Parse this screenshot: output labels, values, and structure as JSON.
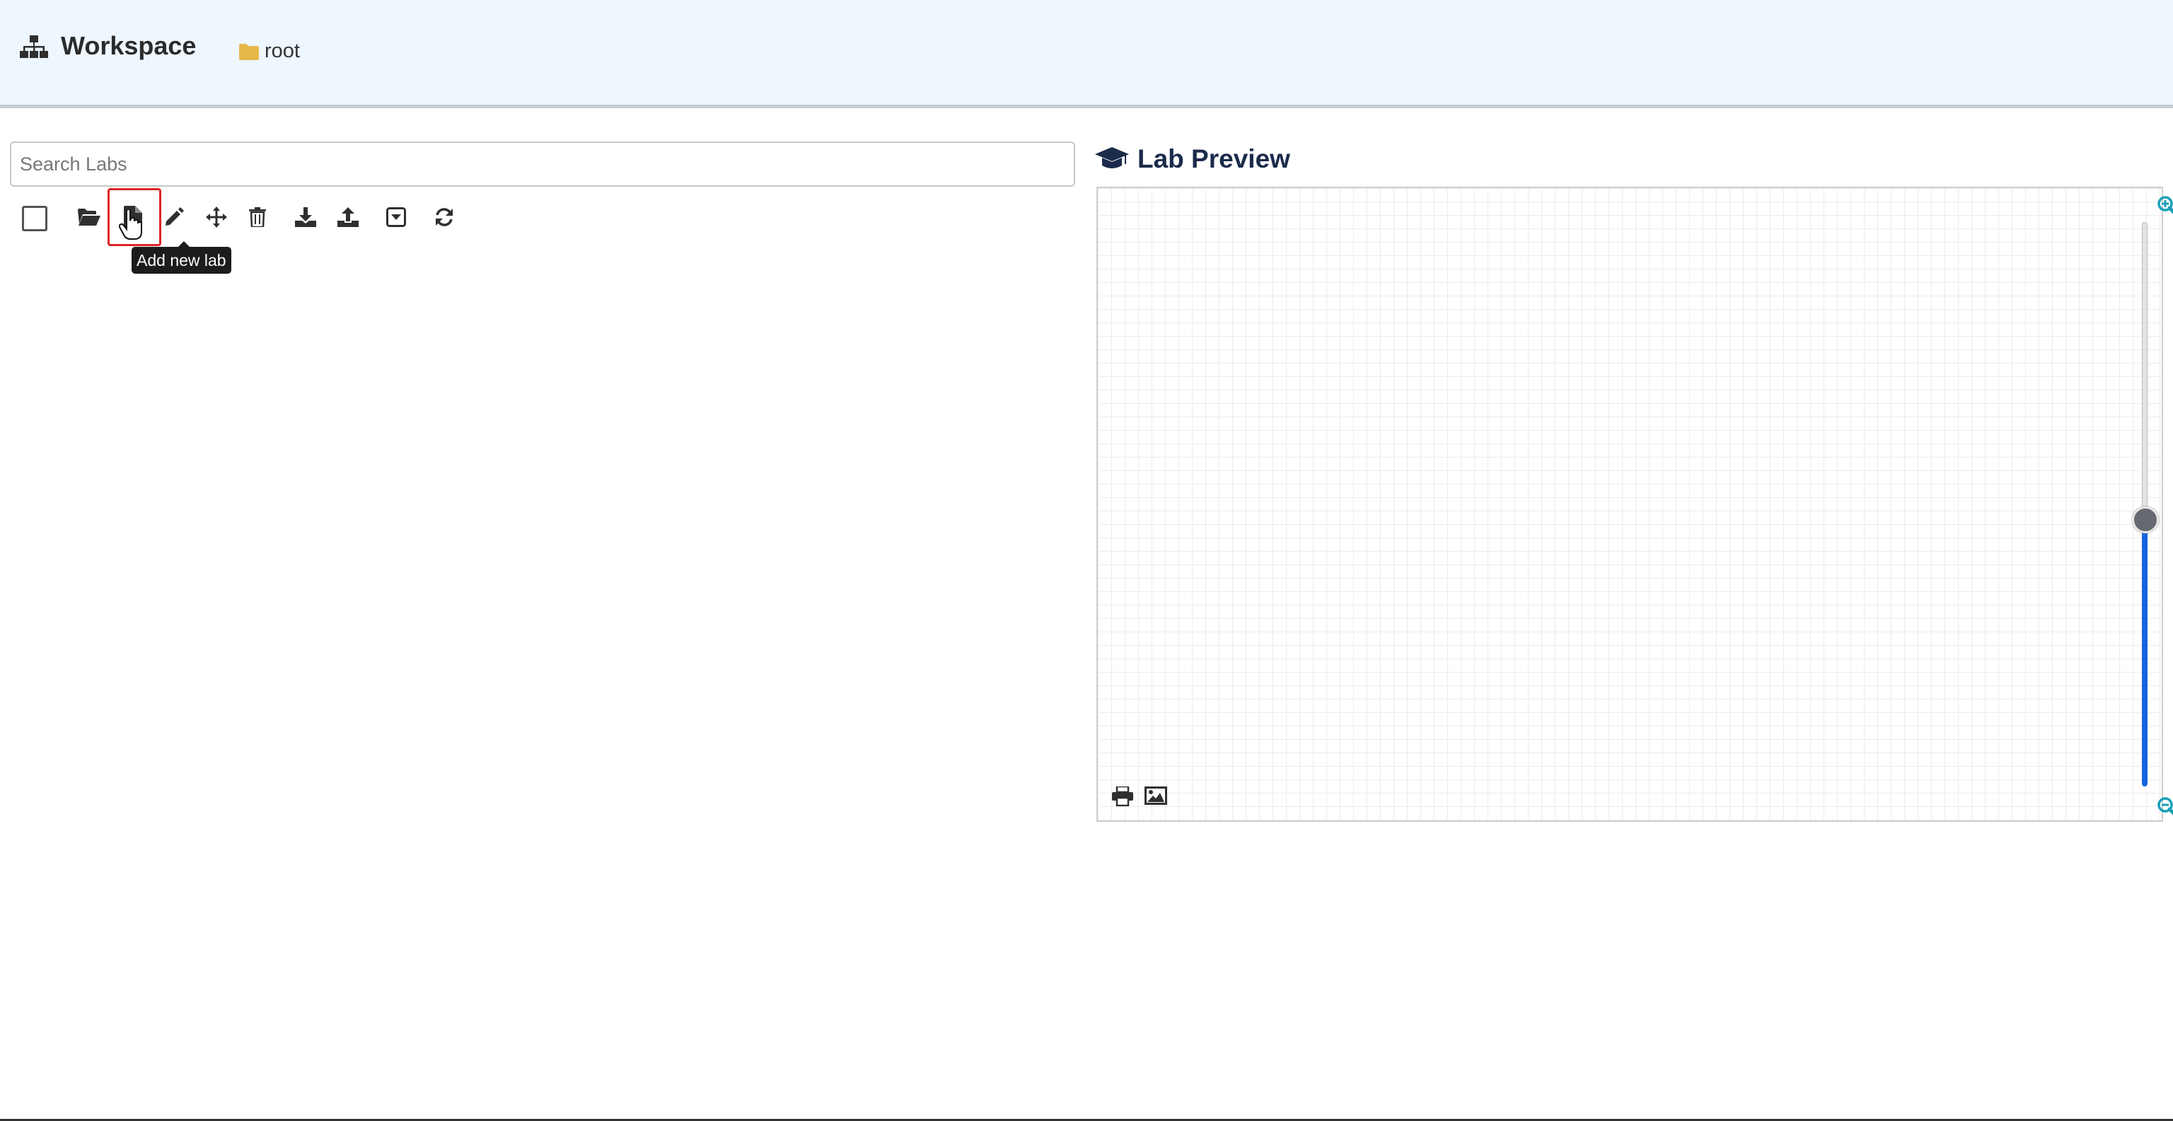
{
  "header": {
    "title": "Workspace",
    "breadcrumb": {
      "label": "root"
    }
  },
  "search": {
    "placeholder": "Search Labs",
    "value": ""
  },
  "toolbar": {
    "tooltip": "Add new lab",
    "buttons": [
      {
        "icon": "folder-open-icon"
      },
      {
        "icon": "new-file-icon"
      },
      {
        "icon": "pencil-icon"
      },
      {
        "icon": "move-icon"
      },
      {
        "icon": "trash-icon"
      },
      {
        "icon": "download-icon"
      },
      {
        "icon": "upload-icon"
      },
      {
        "icon": "caret-square-down-icon"
      },
      {
        "icon": "refresh-icon"
      }
    ]
  },
  "preview": {
    "title": "Lab Preview",
    "zoom_level": 0.45
  },
  "colors": {
    "header_bg": "#eef6fe",
    "accent": "#1565e0",
    "highlight": "#e02424",
    "folder": "#e6b84a"
  }
}
